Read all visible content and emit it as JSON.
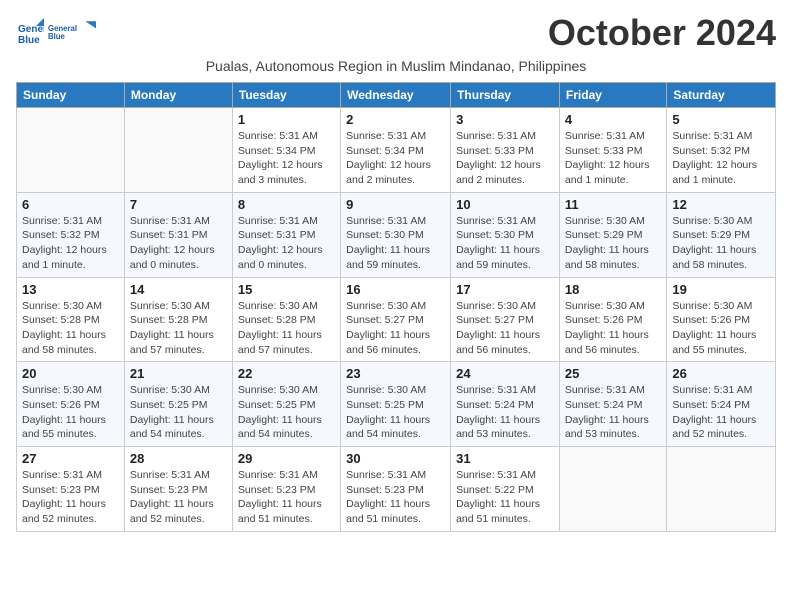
{
  "logo": {
    "line1": "General",
    "line2": "Blue"
  },
  "title": "October 2024",
  "subtitle": "Pualas, Autonomous Region in Muslim Mindanao, Philippines",
  "weekdays": [
    "Sunday",
    "Monday",
    "Tuesday",
    "Wednesday",
    "Thursday",
    "Friday",
    "Saturday"
  ],
  "weeks": [
    [
      null,
      null,
      {
        "day": "1",
        "sunrise": "Sunrise: 5:31 AM",
        "sunset": "Sunset: 5:34 PM",
        "daylight": "Daylight: 12 hours and 3 minutes."
      },
      {
        "day": "2",
        "sunrise": "Sunrise: 5:31 AM",
        "sunset": "Sunset: 5:34 PM",
        "daylight": "Daylight: 12 hours and 2 minutes."
      },
      {
        "day": "3",
        "sunrise": "Sunrise: 5:31 AM",
        "sunset": "Sunset: 5:33 PM",
        "daylight": "Daylight: 12 hours and 2 minutes."
      },
      {
        "day": "4",
        "sunrise": "Sunrise: 5:31 AM",
        "sunset": "Sunset: 5:33 PM",
        "daylight": "Daylight: 12 hours and 1 minute."
      },
      {
        "day": "5",
        "sunrise": "Sunrise: 5:31 AM",
        "sunset": "Sunset: 5:32 PM",
        "daylight": "Daylight: 12 hours and 1 minute."
      }
    ],
    [
      {
        "day": "6",
        "sunrise": "Sunrise: 5:31 AM",
        "sunset": "Sunset: 5:32 PM",
        "daylight": "Daylight: 12 hours and 1 minute."
      },
      {
        "day": "7",
        "sunrise": "Sunrise: 5:31 AM",
        "sunset": "Sunset: 5:31 PM",
        "daylight": "Daylight: 12 hours and 0 minutes."
      },
      {
        "day": "8",
        "sunrise": "Sunrise: 5:31 AM",
        "sunset": "Sunset: 5:31 PM",
        "daylight": "Daylight: 12 hours and 0 minutes."
      },
      {
        "day": "9",
        "sunrise": "Sunrise: 5:31 AM",
        "sunset": "Sunset: 5:30 PM",
        "daylight": "Daylight: 11 hours and 59 minutes."
      },
      {
        "day": "10",
        "sunrise": "Sunrise: 5:31 AM",
        "sunset": "Sunset: 5:30 PM",
        "daylight": "Daylight: 11 hours and 59 minutes."
      },
      {
        "day": "11",
        "sunrise": "Sunrise: 5:30 AM",
        "sunset": "Sunset: 5:29 PM",
        "daylight": "Daylight: 11 hours and 58 minutes."
      },
      {
        "day": "12",
        "sunrise": "Sunrise: 5:30 AM",
        "sunset": "Sunset: 5:29 PM",
        "daylight": "Daylight: 11 hours and 58 minutes."
      }
    ],
    [
      {
        "day": "13",
        "sunrise": "Sunrise: 5:30 AM",
        "sunset": "Sunset: 5:28 PM",
        "daylight": "Daylight: 11 hours and 58 minutes."
      },
      {
        "day": "14",
        "sunrise": "Sunrise: 5:30 AM",
        "sunset": "Sunset: 5:28 PM",
        "daylight": "Daylight: 11 hours and 57 minutes."
      },
      {
        "day": "15",
        "sunrise": "Sunrise: 5:30 AM",
        "sunset": "Sunset: 5:28 PM",
        "daylight": "Daylight: 11 hours and 57 minutes."
      },
      {
        "day": "16",
        "sunrise": "Sunrise: 5:30 AM",
        "sunset": "Sunset: 5:27 PM",
        "daylight": "Daylight: 11 hours and 56 minutes."
      },
      {
        "day": "17",
        "sunrise": "Sunrise: 5:30 AM",
        "sunset": "Sunset: 5:27 PM",
        "daylight": "Daylight: 11 hours and 56 minutes."
      },
      {
        "day": "18",
        "sunrise": "Sunrise: 5:30 AM",
        "sunset": "Sunset: 5:26 PM",
        "daylight": "Daylight: 11 hours and 56 minutes."
      },
      {
        "day": "19",
        "sunrise": "Sunrise: 5:30 AM",
        "sunset": "Sunset: 5:26 PM",
        "daylight": "Daylight: 11 hours and 55 minutes."
      }
    ],
    [
      {
        "day": "20",
        "sunrise": "Sunrise: 5:30 AM",
        "sunset": "Sunset: 5:26 PM",
        "daylight": "Daylight: 11 hours and 55 minutes."
      },
      {
        "day": "21",
        "sunrise": "Sunrise: 5:30 AM",
        "sunset": "Sunset: 5:25 PM",
        "daylight": "Daylight: 11 hours and 54 minutes."
      },
      {
        "day": "22",
        "sunrise": "Sunrise: 5:30 AM",
        "sunset": "Sunset: 5:25 PM",
        "daylight": "Daylight: 11 hours and 54 minutes."
      },
      {
        "day": "23",
        "sunrise": "Sunrise: 5:30 AM",
        "sunset": "Sunset: 5:25 PM",
        "daylight": "Daylight: 11 hours and 54 minutes."
      },
      {
        "day": "24",
        "sunrise": "Sunrise: 5:31 AM",
        "sunset": "Sunset: 5:24 PM",
        "daylight": "Daylight: 11 hours and 53 minutes."
      },
      {
        "day": "25",
        "sunrise": "Sunrise: 5:31 AM",
        "sunset": "Sunset: 5:24 PM",
        "daylight": "Daylight: 11 hours and 53 minutes."
      },
      {
        "day": "26",
        "sunrise": "Sunrise: 5:31 AM",
        "sunset": "Sunset: 5:24 PM",
        "daylight": "Daylight: 11 hours and 52 minutes."
      }
    ],
    [
      {
        "day": "27",
        "sunrise": "Sunrise: 5:31 AM",
        "sunset": "Sunset: 5:23 PM",
        "daylight": "Daylight: 11 hours and 52 minutes."
      },
      {
        "day": "28",
        "sunrise": "Sunrise: 5:31 AM",
        "sunset": "Sunset: 5:23 PM",
        "daylight": "Daylight: 11 hours and 52 minutes."
      },
      {
        "day": "29",
        "sunrise": "Sunrise: 5:31 AM",
        "sunset": "Sunset: 5:23 PM",
        "daylight": "Daylight: 11 hours and 51 minutes."
      },
      {
        "day": "30",
        "sunrise": "Sunrise: 5:31 AM",
        "sunset": "Sunset: 5:23 PM",
        "daylight": "Daylight: 11 hours and 51 minutes."
      },
      {
        "day": "31",
        "sunrise": "Sunrise: 5:31 AM",
        "sunset": "Sunset: 5:22 PM",
        "daylight": "Daylight: 11 hours and 51 minutes."
      },
      null,
      null
    ]
  ]
}
